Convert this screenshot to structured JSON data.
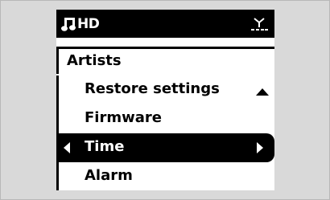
{
  "status_bar": {
    "source_icon": "music-note-icon",
    "source_label": "HD",
    "signal_icon": "antenna-signal-icon"
  },
  "breadcrumb": {
    "label": "Artists"
  },
  "menu": {
    "scroll_indicator": "scroll-up-arrow",
    "selected_index": 2,
    "items": [
      {
        "label": "Restore settings"
      },
      {
        "label": "Firmware"
      },
      {
        "label": "Time"
      },
      {
        "label": "Alarm"
      }
    ]
  },
  "colors": {
    "background": "#d9d9d9",
    "screen": "#ffffff",
    "highlight": "#000000"
  }
}
